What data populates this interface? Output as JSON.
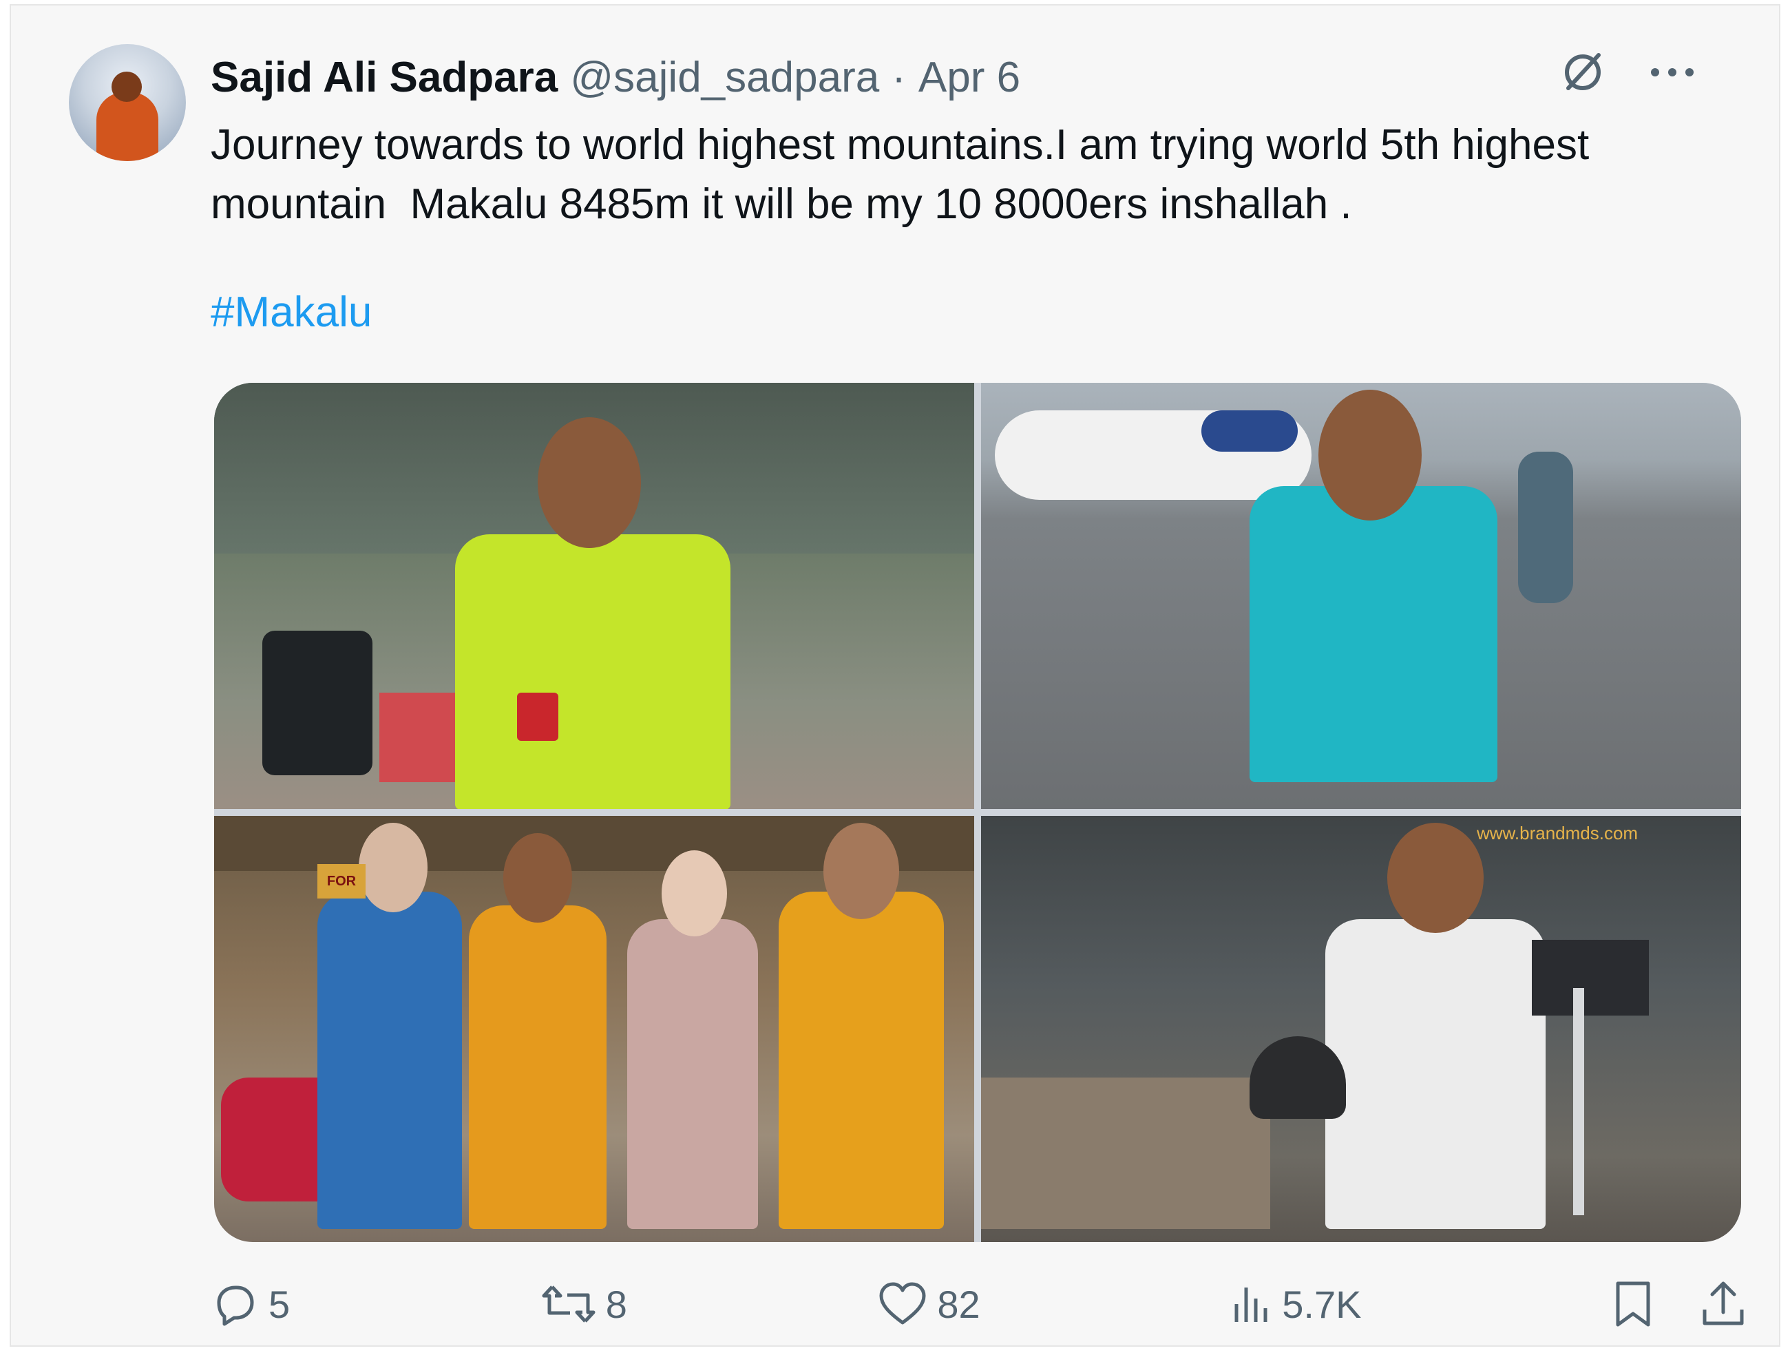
{
  "tweet": {
    "author_name": "Sajid Ali Sadpara",
    "handle": "@sajid_sadpara",
    "separator": "·",
    "date": "Apr 6",
    "text": "Journey towards to world highest mountains.I am trying world 5th highest\nmountain  Makalu 8485m it will be my 10 8000ers inshallah .",
    "hashtag": "#Makalu"
  },
  "icons": {
    "grok": "grok-icon",
    "more": "more-icon",
    "reply": "reply-icon",
    "retweet": "retweet-icon",
    "like": "like-icon",
    "views": "views-icon",
    "bookmark": "bookmark-icon",
    "share": "share-icon"
  },
  "media": {
    "photos": [
      {
        "label": "photo-1"
      },
      {
        "label": "photo-2"
      },
      {
        "label": "photo-3",
        "text": "FOR"
      },
      {
        "label": "photo-4",
        "text": "www.brandmds.com"
      }
    ]
  },
  "actions": {
    "replies": "5",
    "retweets": "8",
    "likes": "82",
    "views": "5.7K"
  },
  "colors": {
    "link": "#1d9bf0",
    "secondary_text": "#536471",
    "primary_text": "#0f1419",
    "card_bg": "#f7f7f7"
  }
}
